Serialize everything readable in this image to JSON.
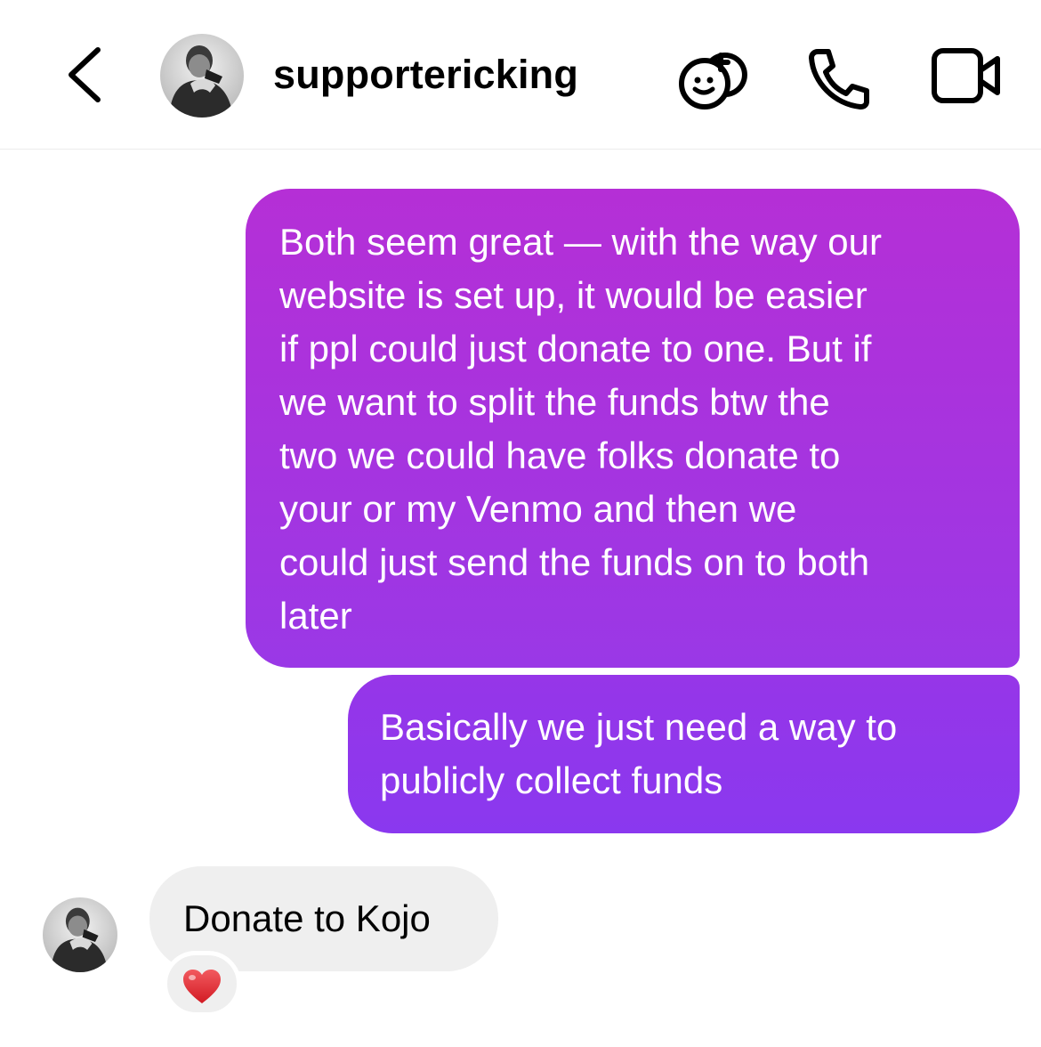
{
  "header": {
    "username": "supportericking",
    "icons": {
      "back": "chevron-left-icon",
      "effects": "effects-sticker-icon",
      "call": "phone-icon",
      "video": "video-camera-icon"
    }
  },
  "messages": {
    "outgoing": [
      {
        "lines": [
          "Both seem great — with the way our",
          "website is set up, it would be easier",
          "if ppl could just donate to one. But if",
          "we want to split the funds btw the",
          "two we could have folks donate to",
          "your or my Venmo and then we",
          "could just send the funds on to both",
          "later"
        ]
      },
      {
        "lines": [
          "Basically we just need a way to",
          "publicly collect funds"
        ]
      }
    ],
    "incoming": {
      "text": "Donate to Kojo",
      "reaction": "❤️",
      "reaction_icon": "red-heart-icon"
    }
  },
  "colors": {
    "outgoing_top": "#b52fd6",
    "outgoing_bottom": "#8a38ef",
    "incoming_bubble": "#efefef",
    "heart": "#e0262f"
  }
}
